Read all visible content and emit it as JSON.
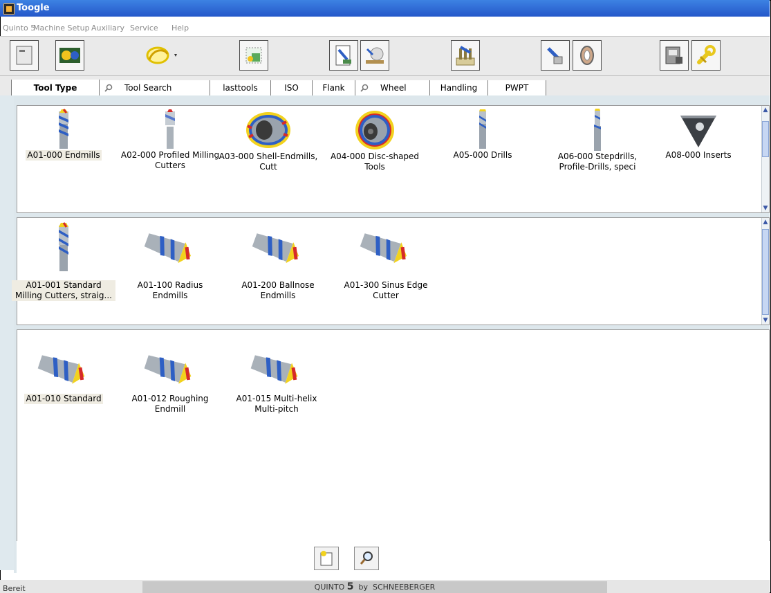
{
  "window": {
    "title": "Toogle"
  },
  "menu": [
    "Quinto 5",
    "Machine Setup",
    "Auxiliary",
    "Service",
    "Help"
  ],
  "toolbar": {
    "buttons": [
      {
        "name": "window-icon"
      },
      {
        "name": "machine-icon"
      },
      {
        "name": "curve-tool-icon"
      },
      {
        "name": "grid-view-icon"
      },
      {
        "name": "document-transfer-icon"
      },
      {
        "name": "grinding-icon"
      },
      {
        "name": "tool-holder-icon"
      },
      {
        "name": "measure-icon"
      },
      {
        "name": "wheel-icon"
      },
      {
        "name": "machine-panel-icon"
      },
      {
        "name": "wrench-icon"
      }
    ]
  },
  "tabs": [
    {
      "label": "Tool Type",
      "active": true
    },
    {
      "label": "Tool Search",
      "icon": "search-icon"
    },
    {
      "label": "lasttools"
    },
    {
      "label": "ISO"
    },
    {
      "label": "Flank"
    },
    {
      "label": "Wheel",
      "icon": "search-icon"
    },
    {
      "label": "Handling"
    },
    {
      "label": "PWPT"
    }
  ],
  "panels": {
    "categories": [
      {
        "label": "A01-000 Endmills",
        "shape": "endmill",
        "selected": true
      },
      {
        "label": "A02-000 Profiled Milling Cutters",
        "shape": "profiled"
      },
      {
        "label": "A03-000 Shell-Endmills, Cutt",
        "shape": "shell"
      },
      {
        "label": "A04-000 Disc-shaped Tools",
        "shape": "disc"
      },
      {
        "label": "A05-000 Drills",
        "shape": "drill"
      },
      {
        "label": "A06-000 Stepdrills, Profile-Drills, speci",
        "shape": "stepdrill"
      },
      {
        "label": "A08-000 Inserts",
        "shape": "insert"
      }
    ],
    "subcategories": [
      {
        "label": "A01-001 Standard Milling Cutters, straig...",
        "shape": "endmill",
        "selected": true
      },
      {
        "label": "A01-100 Radius Endmills",
        "shape": "sidecutter"
      },
      {
        "label": "A01-200 Ballnose Endmills",
        "shape": "sidecutter"
      },
      {
        "label": "A01-300 Sinus Edge Cutter",
        "shape": "sidecutter"
      }
    ],
    "types": [
      {
        "label": "A01-010 Standard",
        "shape": "sidecutter",
        "selected": true
      },
      {
        "label": "A01-012 Roughing Endmill",
        "shape": "sidecutter"
      },
      {
        "label": "A01-015 Multi-helix Multi-pitch",
        "shape": "sidecutter"
      }
    ]
  },
  "bottom_buttons": [
    {
      "name": "new-document-button",
      "icon": "new-document-icon"
    },
    {
      "name": "search-button",
      "icon": "search-icon"
    }
  ],
  "status": {
    "text": "Bereit",
    "brand": "QUINTO",
    "brand_version": "5",
    "brand_by": "by",
    "brand_company": "SCHNEEBERGER"
  },
  "colors": {
    "titlebar": "#2457c9",
    "tool_steel": "#9aa3ad",
    "tool_blue": "#2e5fc4",
    "tool_yellow": "#f2d21e",
    "tool_red": "#d62a2a",
    "selected_caption_bg": "#efece2"
  }
}
